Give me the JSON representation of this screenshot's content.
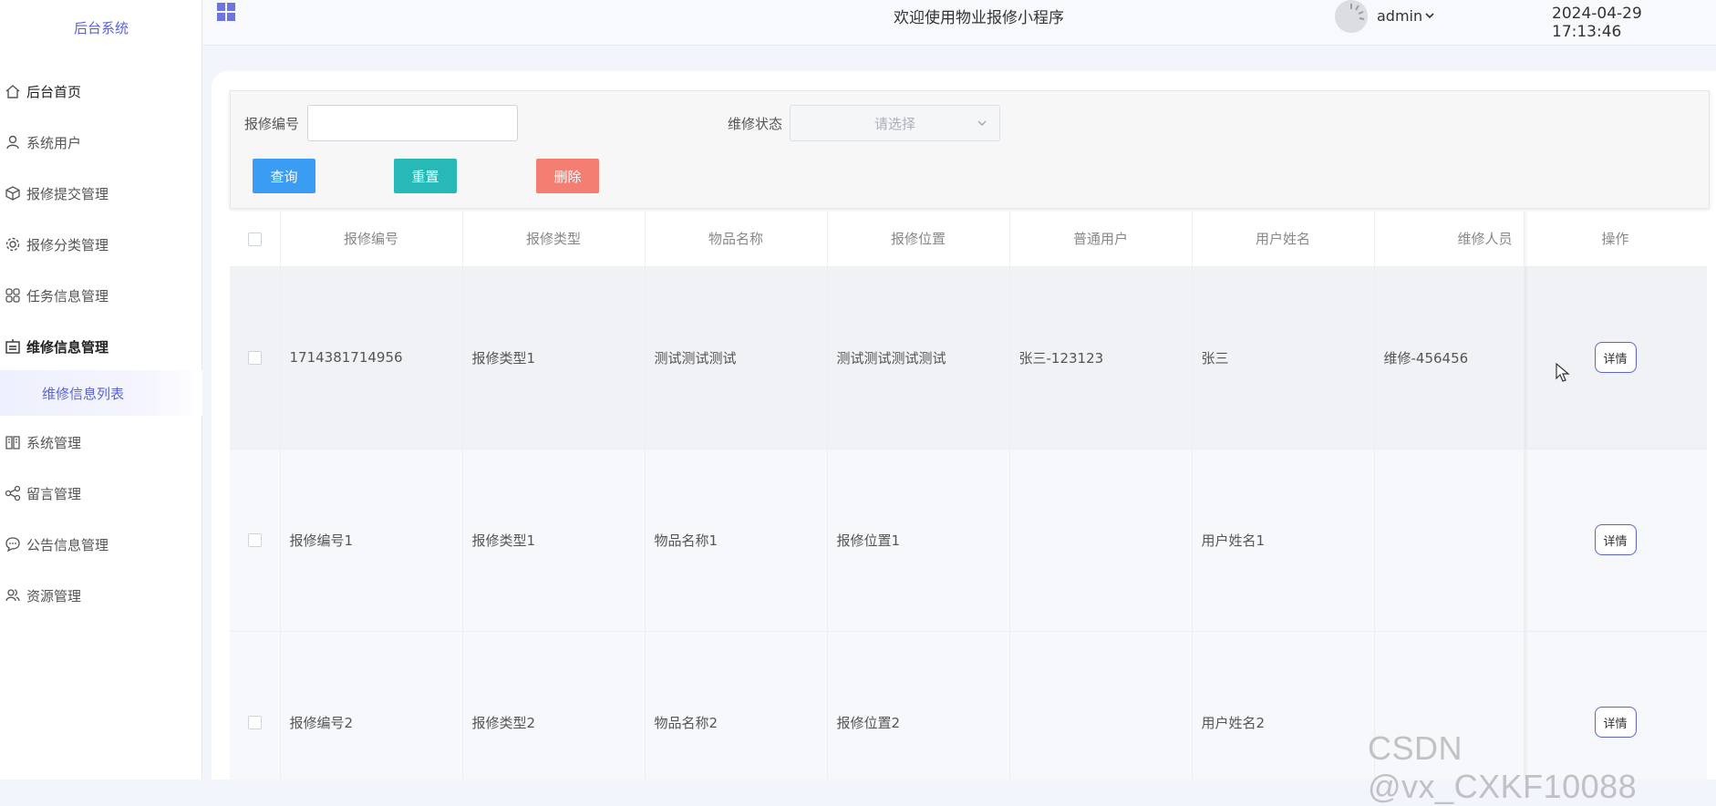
{
  "sidebar": {
    "brand": "后台系统",
    "items": [
      {
        "label": "后台首页"
      },
      {
        "label": "系统用户"
      },
      {
        "label": "报修提交管理"
      },
      {
        "label": "报修分类管理"
      },
      {
        "label": "任务信息管理"
      },
      {
        "label": "维修信息管理"
      },
      {
        "label": "系统管理"
      },
      {
        "label": "留言管理"
      },
      {
        "label": "公告信息管理"
      },
      {
        "label": "资源管理"
      }
    ],
    "sub_item": "维修信息列表"
  },
  "header": {
    "welcome": "欢迎使用物业报修小程序",
    "user": "admin",
    "datetime": "2024-04-29 17:13:46"
  },
  "search": {
    "repair_no_label": "报修编号",
    "repair_no_value": "",
    "status_label": "维修状态",
    "status_placeholder": "请选择",
    "query_btn": "查询",
    "reset_btn": "重置",
    "delete_btn": "删除"
  },
  "colors": {
    "query": "#3a9cf2",
    "reset": "#26b9b7",
    "delete": "#f47e72",
    "accent": "#5b63d8"
  },
  "table": {
    "headers": [
      "报修编号",
      "报修类型",
      "物品名称",
      "报修位置",
      "普通用户",
      "用户姓名",
      "维修人员",
      "操作"
    ],
    "rows": [
      [
        "1714381714956",
        "报修类型1",
        "测试测试测试",
        "测试测试测试测试",
        "张三-123123",
        "张三",
        "维修-456456"
      ],
      [
        "报修编号1",
        "报修类型1",
        "物品名称1",
        "报修位置1",
        "",
        "用户姓名1",
        ""
      ],
      [
        "报修编号2",
        "报修类型2",
        "物品名称2",
        "报修位置2",
        "",
        "用户姓名2",
        ""
      ]
    ],
    "detail_label": "详情"
  },
  "watermark": "CSDN @vx_CXKF10088"
}
